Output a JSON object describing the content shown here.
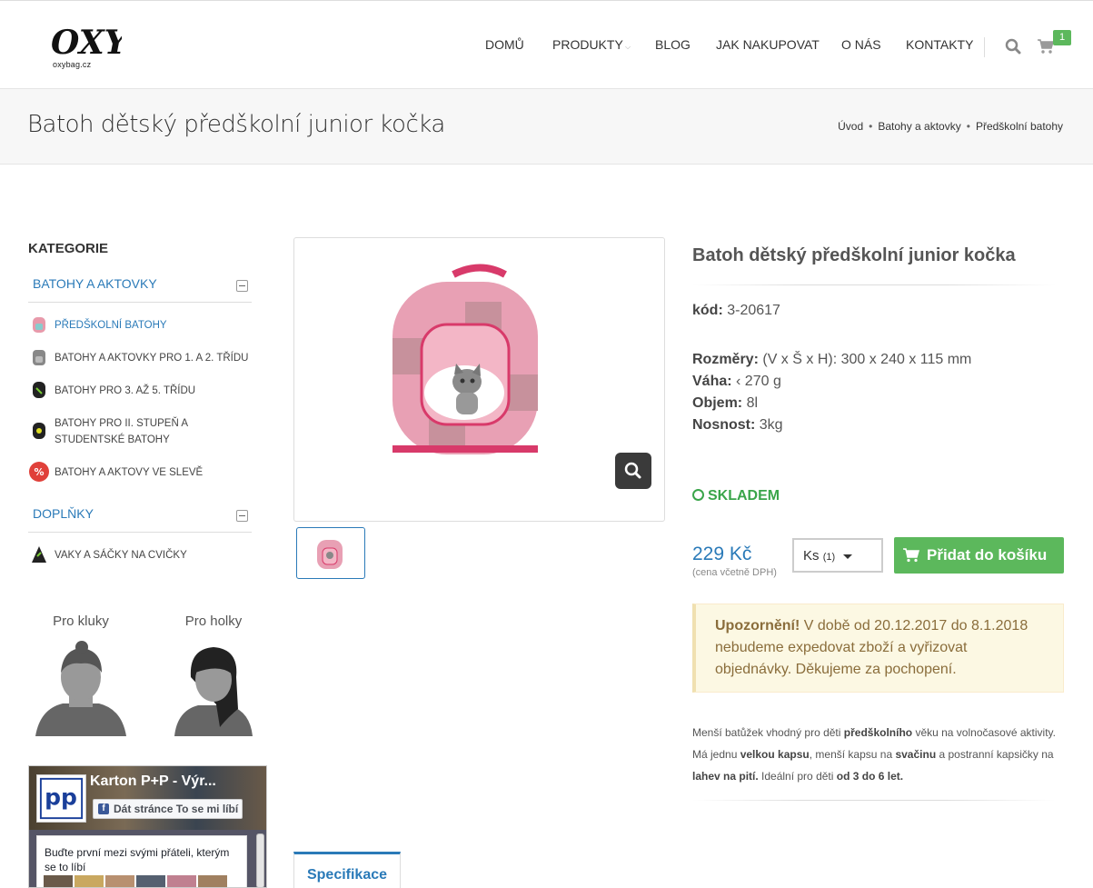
{
  "header": {
    "logo_text": "oxybag.cz",
    "nav": [
      "DOMŮ",
      "PRODUKTY",
      "BLOG",
      "JAK NAKUPOVAT",
      "O NÁS",
      "KONTAKTY"
    ],
    "cart_count": "1"
  },
  "title_bar": {
    "title": "Batoh dětský předškolní junior kočka",
    "breadcrumb": [
      "Úvod",
      "Batohy a aktovky",
      "Předškolní batohy"
    ]
  },
  "sidebar": {
    "heading": "KATEGORIE",
    "groups": [
      {
        "label": "BATOHY A AKTOVKY",
        "items": [
          "PŘEDŠKOLNÍ BATOHY",
          "BATOHY A AKTOVKY PRO 1. A 2. TŘÍDU",
          "BATOHY PRO 3. AŽ 5. TŘÍDU",
          "BATOHY PRO II. STUPEŇ A STUDENTSKÉ BATOHY",
          "BATOHY A AKTOVY VE SLEVĚ"
        ]
      },
      {
        "label": "DOPLŇKY",
        "items": [
          "VAKY A SÁČKY NA CVIČKY"
        ]
      }
    ],
    "avatars": [
      "Pro kluky",
      "Pro holky"
    ],
    "facebook": {
      "page_title": "Karton P+P - Výr...",
      "like_label": "Dát stránce To se mi líbí",
      "body_text": "Buďte první mezi svými přáteli, kterým se to líbí"
    }
  },
  "product": {
    "title": "Batoh dětský předškolní junior kočka",
    "code_label": "kód:",
    "code": "3-20617",
    "specs": [
      {
        "label": "Rozměry:",
        "value": "(V x Š x H): 300 x 240 x 115 mm"
      },
      {
        "label": "Váha:",
        "value": "‹ 270 g"
      },
      {
        "label": "Objem:",
        "value": "8l"
      },
      {
        "label": "Nosnost:",
        "value": "3kg"
      }
    ],
    "stock": "SKLADEM",
    "price": "229 Kč",
    "price_note": "(cena včetně DPH)",
    "qty_label": "Ks",
    "qty_value": "(1)",
    "add_to_cart": "Přidat do košíku",
    "notice_bold": "Upozornění!",
    "notice_text": " V době od 20.12.2017 do 8.1.2018 nebudeme expedovat zboží a vyřizovat objednávky. Děkujeme za pochopení.",
    "description_parts": [
      {
        "t": "Menší batůžek vhodný pro děti ",
        "b": false
      },
      {
        "t": "předškolního",
        "b": true
      },
      {
        "t": " věku na volnočasové aktivity. Má jednu ",
        "b": false
      },
      {
        "t": "velkou kapsu",
        "b": true
      },
      {
        "t": ", menší kapsu na ",
        "b": false
      },
      {
        "t": "svačinu",
        "b": true
      },
      {
        "t": " a postranní kapsičky na ",
        "b": false
      },
      {
        "t": "lahev na pití.",
        "b": true
      },
      {
        "t": " Ideální pro děti ",
        "b": false
      },
      {
        "t": "od 3 do 6 let.",
        "b": true
      }
    ],
    "tab": "Specifikace"
  },
  "colors": {
    "accent_blue": "#2a7ab8",
    "green": "#5cb85c",
    "notice_bg": "#fcf8e3"
  }
}
